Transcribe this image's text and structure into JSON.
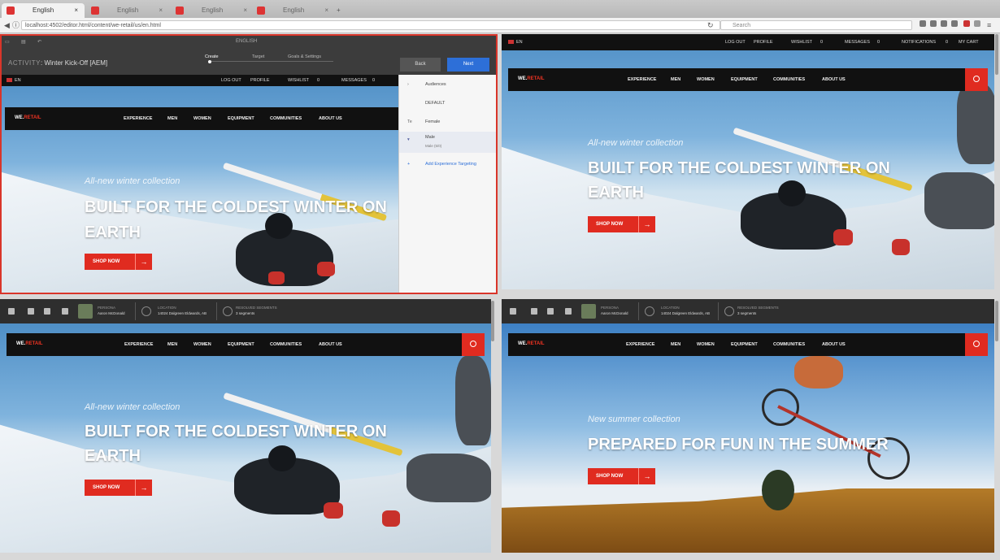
{
  "browser": {
    "tabs": [
      {
        "title": "English"
      },
      {
        "title": "English"
      },
      {
        "title": "English"
      },
      {
        "title": "English"
      }
    ],
    "url": "localhost:4502/editor.html/content/we-retail/us/en.html",
    "search_placeholder": "Search"
  },
  "editor": {
    "language": "ENGLISH",
    "activity_label": "ACTIVITY",
    "activity_name": "Winter Kick-Off [AEM]",
    "steps": [
      "Create",
      "Target",
      "Goals & Settings"
    ],
    "back_label": "Back",
    "next_label": "Next",
    "side_items": [
      {
        "icon": "›",
        "label": "Audiences"
      },
      {
        "icon": "",
        "label": "DEFAULT"
      },
      {
        "icon": "Te",
        "label": "Female"
      },
      {
        "icon": "▾",
        "label": "Male",
        "sub": "Male (5/0)"
      },
      {
        "icon": "+",
        "label": "Add Experience Targeting"
      }
    ]
  },
  "site": {
    "lang": "EN",
    "log_out": "LOG OUT",
    "profile": "PROFILE",
    "wishlist": "WISHLIST",
    "messages": "MESSAGES",
    "notifications": "NOTIFICATIONS",
    "my_cart": "MY CART",
    "count": "0",
    "logo_we": "WE.",
    "logo_retail": "RETAIL",
    "nav": [
      "EXPERIENCE",
      "MEN",
      "WOMEN",
      "EQUIPMENT",
      "COMMUNITIES",
      "ABOUT US"
    ],
    "shop_now": "SHOP NOW",
    "winter_kicker": "All-new winter collection",
    "winter_headline": "BUILT FOR THE COLDEST WINTER ON EARTH",
    "summer_kicker": "New summer collection",
    "summer_headline": "PREPARED FOR FUN IN THE SUMMER"
  },
  "context": {
    "persona_label": "PERSONA",
    "persona_value": "Aaron McDonald",
    "location_label": "LOCATION",
    "location_value": "14024 Dalgreen Eldwards, AB",
    "segments_label": "RESOLVED SEGMENTS",
    "segments_value": "3 segments"
  }
}
